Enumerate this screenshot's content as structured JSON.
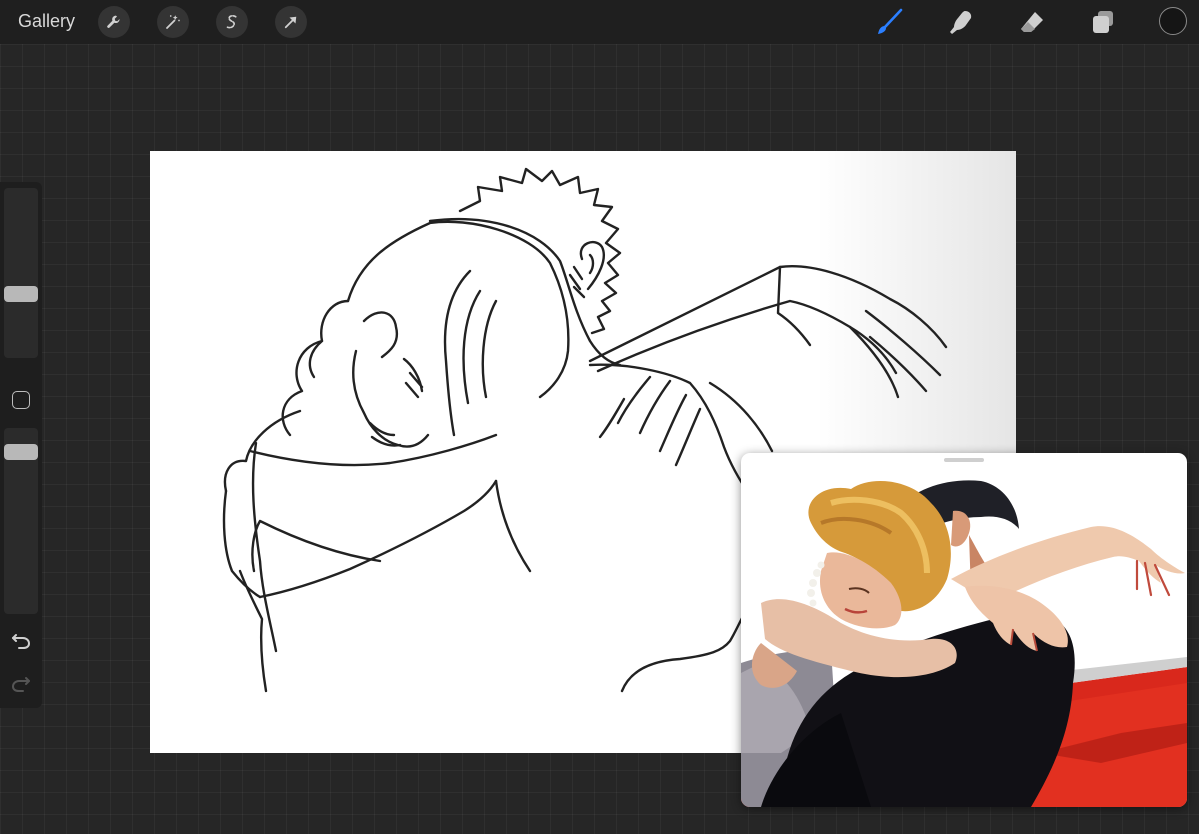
{
  "topbar": {
    "gallery_label": "Gallery",
    "left_tools": [
      {
        "name": "actions",
        "icon": "wrench-icon"
      },
      {
        "name": "adjustments",
        "icon": "magic-wand-icon"
      },
      {
        "name": "selection",
        "icon": "selection-s-icon"
      },
      {
        "name": "transform",
        "icon": "arrow-cursor-icon"
      }
    ],
    "right_tools": [
      {
        "name": "brush",
        "icon": "brush-icon",
        "active": true
      },
      {
        "name": "smudge",
        "icon": "smudge-finger-icon",
        "active": false
      },
      {
        "name": "eraser",
        "icon": "eraser-icon",
        "active": false
      },
      {
        "name": "layers",
        "icon": "layers-icon",
        "active": false
      }
    ],
    "color_well": {
      "icon": "color-circle-icon",
      "color": "#151515"
    }
  },
  "sidebar": {
    "brush_size_level": 0.62,
    "opacity_level": 0.9,
    "modify_icon": "square-icon",
    "undo_icon": "undo-arrow-icon",
    "redo_icon": "redo-arrow-icon"
  },
  "colors": {
    "accent": "#2b7fff",
    "background": "#262626",
    "toolbar": "#1f1f1f",
    "icon": "#cfcfcf",
    "stroke": "#222222"
  },
  "canvas": {
    "content": "line-art-sketch-of-embracing-couple"
  },
  "reference": {
    "content": "painted-illustration-of-embracing-couple"
  }
}
